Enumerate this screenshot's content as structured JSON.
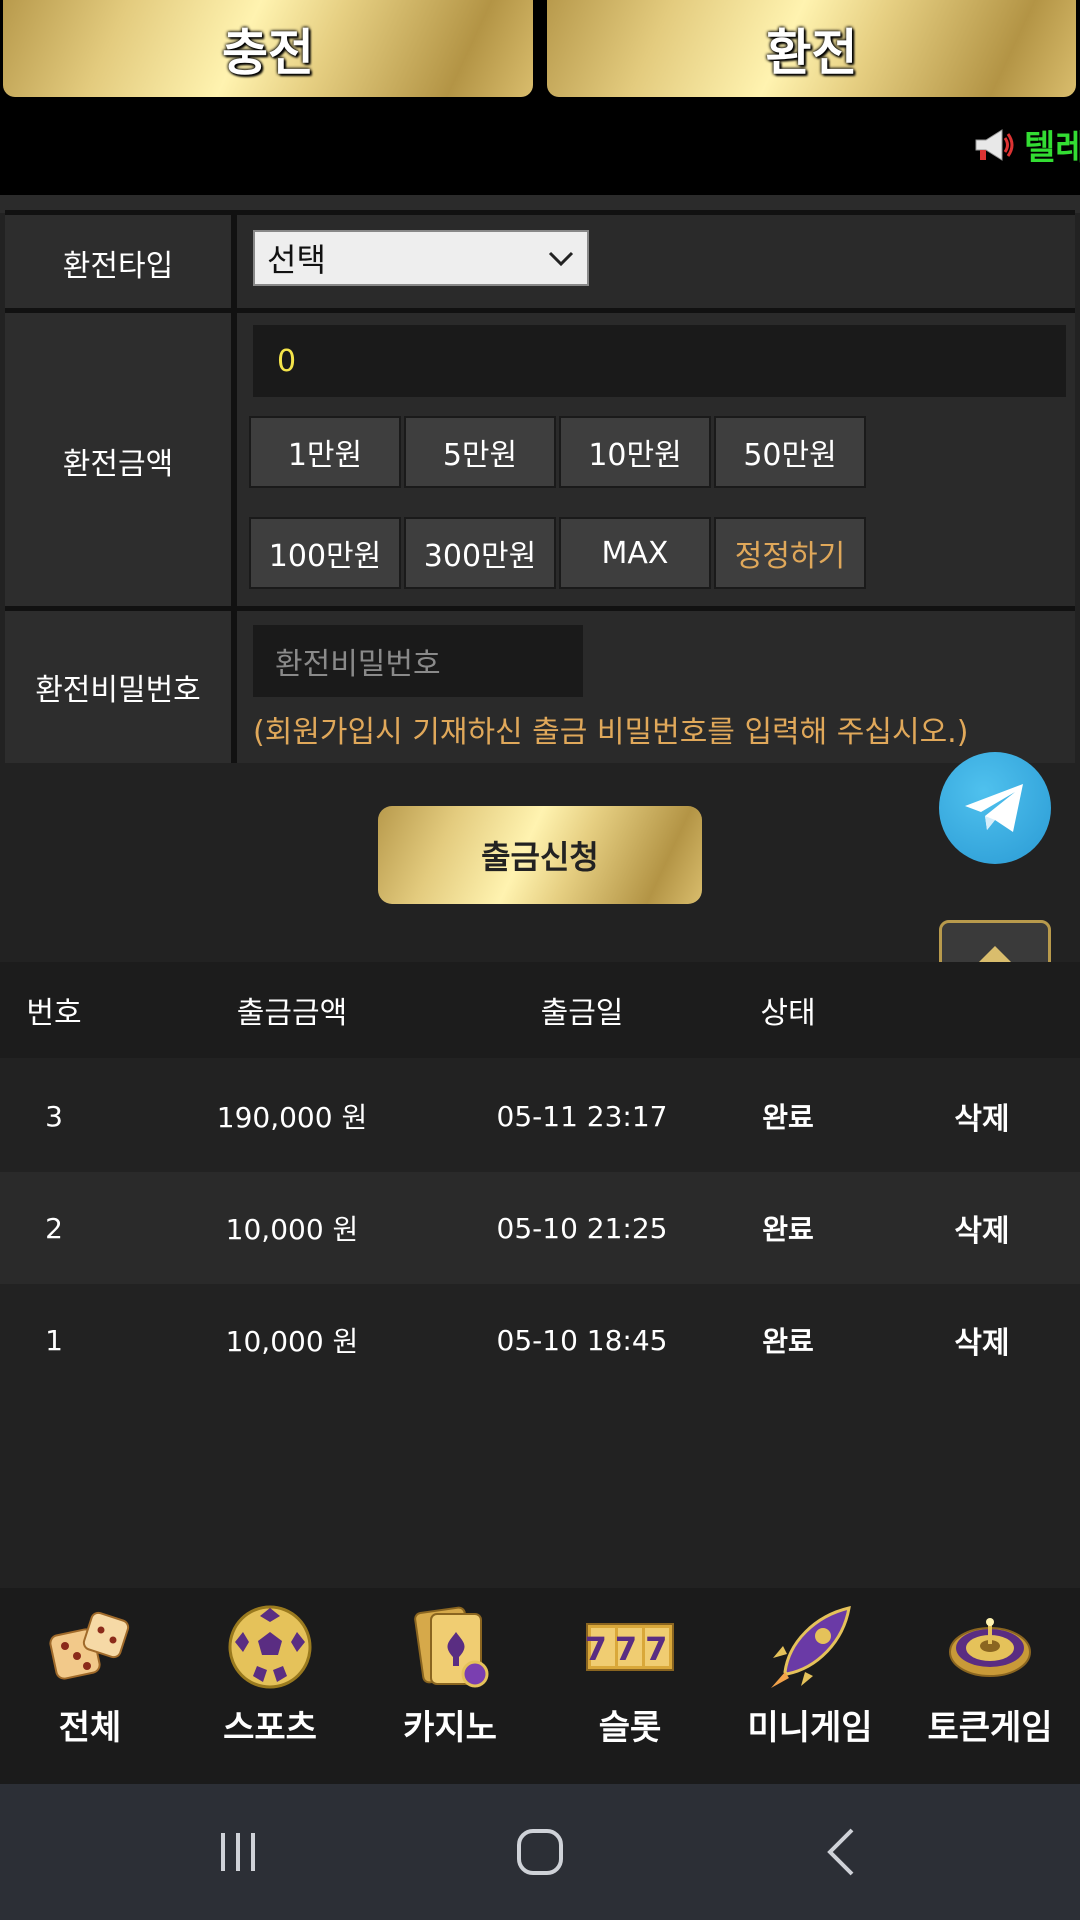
{
  "tabs": {
    "deposit": "충전",
    "withdraw": "환전"
  },
  "marquee": {
    "text": "텔레"
  },
  "form": {
    "type_label": "환전타입",
    "type_selected": "선택",
    "amount_label": "환전금액",
    "amount_value": "0",
    "amount_buttons": [
      "1만원",
      "5만원",
      "10만원",
      "50만원",
      "100만원",
      "300만원",
      "MAX"
    ],
    "reset_label": "정정하기",
    "password_label": "환전비밀번호",
    "password_placeholder": "환전비밀번호",
    "password_note": "(회원가입시 기재하신 출금 비밀번호를 입력해 주십시오.)"
  },
  "submit_label": "출금신청",
  "table": {
    "headers": [
      "번호",
      "출금금액",
      "출금일",
      "상태"
    ],
    "rows": [
      {
        "no": "3",
        "amount": "190,000 원",
        "date": "05-11 23:17",
        "status": "완료",
        "action": "삭제"
      },
      {
        "no": "2",
        "amount": "10,000 원",
        "date": "05-10 21:25",
        "status": "완료",
        "action": "삭제"
      },
      {
        "no": "1",
        "amount": "10,000 원",
        "date": "05-10 18:45",
        "status": "완료",
        "action": "삭제"
      }
    ]
  },
  "nav": {
    "items": [
      {
        "label": "전체",
        "icon": "dice-icon"
      },
      {
        "label": "스포츠",
        "icon": "soccer-ball-icon"
      },
      {
        "label": "카지노",
        "icon": "cards-icon"
      },
      {
        "label": "슬롯",
        "icon": "slot-777-icon"
      },
      {
        "label": "미니게임",
        "icon": "rocket-icon"
      },
      {
        "label": "토큰게임",
        "icon": "roulette-icon"
      }
    ],
    "slot_digits": "777"
  },
  "colors": {
    "accent_gold": "#e3cb7e",
    "marquee_green": "#33dd33",
    "note_orange": "#e0a85a",
    "amount_yellow": "#f4e44a"
  }
}
